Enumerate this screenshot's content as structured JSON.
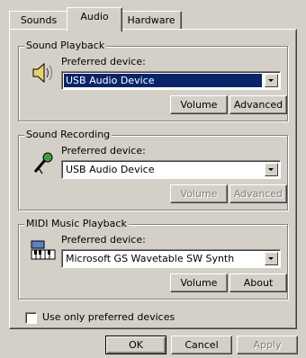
{
  "tabs": [
    {
      "label": "Sounds",
      "active": false
    },
    {
      "label": "Audio",
      "active": true
    },
    {
      "label": "Hardware",
      "active": false
    }
  ],
  "groups": [
    {
      "legend": "Sound Playback",
      "icon": "speaker-icon",
      "pref_label": "Preferred device:",
      "selected": "USB Audio Device",
      "highlighted": true,
      "buttons": [
        {
          "label": "Volume",
          "enabled": true
        },
        {
          "label": "Advanced",
          "enabled": true
        }
      ]
    },
    {
      "legend": "Sound Recording",
      "icon": "microphone-icon",
      "pref_label": "Preferred device:",
      "selected": "USB Audio Device",
      "highlighted": false,
      "buttons": [
        {
          "label": "Volume",
          "enabled": false
        },
        {
          "label": "Advanced",
          "enabled": false
        }
      ]
    },
    {
      "legend": "MIDI Music Playback",
      "icon": "midi-keyboard-icon",
      "pref_label": "Preferred device:",
      "selected": "Microsoft GS Wavetable SW Synth",
      "highlighted": false,
      "buttons": [
        {
          "label": "Volume",
          "enabled": true
        },
        {
          "label": "About",
          "enabled": true
        }
      ]
    }
  ],
  "use_preferred": {
    "label": "Use only preferred devices",
    "checked": false
  },
  "dialog_buttons": [
    {
      "label": "OK",
      "enabled": true
    },
    {
      "label": "Cancel",
      "enabled": true
    },
    {
      "label": "Apply",
      "enabled": false
    }
  ],
  "colors": {
    "face": "#d4d0c8",
    "highlight": "#0a246a",
    "disabled_text": "#808080"
  }
}
